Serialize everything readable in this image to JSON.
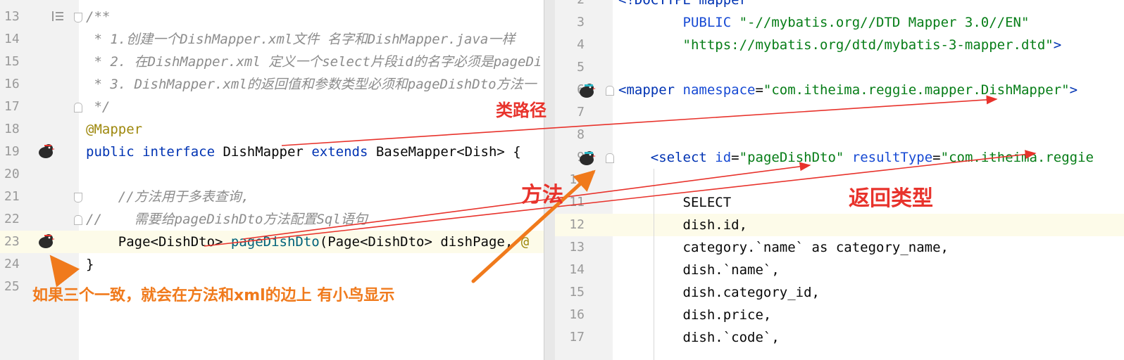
{
  "left_editor": {
    "lines": [
      {
        "num": "13",
        "parts": [
          {
            "c": "cm",
            "t": "/**"
          }
        ]
      },
      {
        "num": "14",
        "parts": [
          {
            "c": "cm",
            "t": " * 1.创建一个DishMapper.xml文件 名字和DishMapper.java一样"
          }
        ]
      },
      {
        "num": "15",
        "parts": [
          {
            "c": "cm",
            "t": " * 2. 在DishMapper.xml 定义一个select片段id的名字必须是pageDi"
          }
        ]
      },
      {
        "num": "16",
        "parts": [
          {
            "c": "cm",
            "t": " * 3. DishMapper.xml的返回值和参数类型必须和pageDishDto方法一"
          }
        ]
      },
      {
        "num": "17",
        "parts": [
          {
            "c": "cm",
            "t": " */"
          }
        ]
      },
      {
        "num": "18",
        "parts": [
          {
            "c": "an",
            "t": "@Mapper"
          }
        ]
      },
      {
        "num": "19",
        "parts": [
          {
            "c": "kw",
            "t": "public interface "
          },
          {
            "c": "tx",
            "t": "DishMapper "
          },
          {
            "c": "kw",
            "t": "extends "
          },
          {
            "c": "tx",
            "t": "BaseMapper<Dish> {"
          }
        ]
      },
      {
        "num": "20",
        "parts": []
      },
      {
        "num": "21",
        "parts": [
          {
            "c": "cm",
            "t": "    //方法用于多表查询,"
          }
        ]
      },
      {
        "num": "22",
        "parts": [
          {
            "c": "cm",
            "t": "//    需要给pageDishDto方法配置Sql语句"
          }
        ]
      },
      {
        "num": "23",
        "parts": [
          {
            "c": "tx",
            "t": "    Page<DishDto> "
          },
          {
            "c": "fn",
            "t": "pageDishDto"
          },
          {
            "c": "tx",
            "t": "(Page<DishDto> dishPage, "
          },
          {
            "c": "an",
            "t": "@"
          }
        ]
      },
      {
        "num": "24",
        "parts": [
          {
            "c": "tx",
            "t": "}"
          }
        ]
      },
      {
        "num": "25",
        "parts": []
      }
    ]
  },
  "right_editor": {
    "lines": [
      {
        "num": "2",
        "parts": [
          {
            "c": "tag",
            "t": "<!DOCTYPE mapper"
          }
        ]
      },
      {
        "num": "3",
        "parts": [
          {
            "c": "att",
            "t": "        PUBLIC "
          },
          {
            "c": "str",
            "t": "\"-//mybatis.org//DTD Mapper 3.0//EN\""
          }
        ]
      },
      {
        "num": "4",
        "parts": [
          {
            "c": "str",
            "t": "        \"https://mybatis.org/dtd/mybatis-3-mapper.dtd\""
          },
          {
            "c": "tag",
            "t": ">"
          }
        ]
      },
      {
        "num": "5",
        "parts": []
      },
      {
        "num": "6",
        "parts": [
          {
            "c": "tag",
            "t": "<mapper "
          },
          {
            "c": "att",
            "t": "namespace"
          },
          {
            "c": "tx",
            "t": "="
          },
          {
            "c": "str",
            "t": "\"com.itheima.reggie.mapper.DishMapper\""
          },
          {
            "c": "tag",
            "t": ">"
          }
        ]
      },
      {
        "num": "7",
        "parts": []
      },
      {
        "num": "8",
        "parts": []
      },
      {
        "num": "9",
        "parts": [
          {
            "c": "tag",
            "t": "    <select "
          },
          {
            "c": "att",
            "t": "id"
          },
          {
            "c": "tx",
            "t": "="
          },
          {
            "c": "str",
            "t": "\"pageDishDto\" "
          },
          {
            "c": "att",
            "t": "resultType"
          },
          {
            "c": "tx",
            "t": "="
          },
          {
            "c": "str",
            "t": "\"com.itheima.reggie"
          }
        ]
      },
      {
        "num": "10",
        "parts": []
      },
      {
        "num": "11",
        "parts": [
          {
            "c": "tx",
            "t": "        SELECT"
          }
        ]
      },
      {
        "num": "12",
        "parts": [
          {
            "c": "tx",
            "t": "        dish.id,"
          }
        ]
      },
      {
        "num": "13",
        "parts": [
          {
            "c": "tx",
            "t": "        category.`name` as category_name,"
          }
        ]
      },
      {
        "num": "14",
        "parts": [
          {
            "c": "tx",
            "t": "        dish.`name`,"
          }
        ]
      },
      {
        "num": "15",
        "parts": [
          {
            "c": "tx",
            "t": "        dish.category_id,"
          }
        ]
      },
      {
        "num": "16",
        "parts": [
          {
            "c": "tx",
            "t": "        dish.price,"
          }
        ]
      },
      {
        "num": "17",
        "parts": [
          {
            "c": "tx",
            "t": "        dish.`code`,"
          }
        ]
      }
    ]
  },
  "annotations": {
    "class_path": "类路径",
    "method": "方法",
    "return_type": "返回类型",
    "bird_note": "如果三个一致，就会在方法和xml的边上 有小鸟显示"
  },
  "colors": {
    "arrow_red": "#e8332c",
    "arrow_orange": "#f07a1c"
  }
}
